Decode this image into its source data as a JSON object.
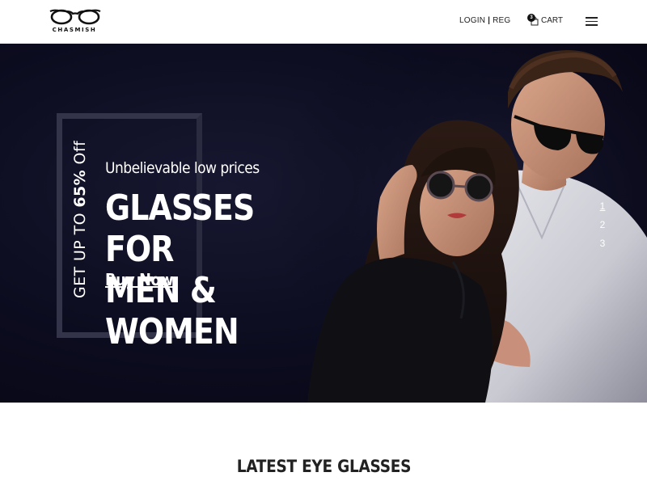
{
  "brand": {
    "name": "CHASMISH"
  },
  "nav": {
    "login": "LOGIN",
    "separator": "|",
    "register": "REG",
    "cart_count": "3",
    "cart_label": "CART"
  },
  "hero": {
    "promo_prefix": "GET UP TO ",
    "promo_highlight": "65%",
    "promo_suffix": " Off",
    "subtitle": "Unbelievable low prices",
    "title_line1": "GLASSES FOR",
    "title_line2": "MEN & WOMEN",
    "cta": "Buy Now",
    "slides": [
      "1",
      "2",
      "3"
    ],
    "active_slide": "1"
  },
  "section": {
    "title": "LATEST EYE GLASSES"
  },
  "colors": {
    "hero_bg": "#0c0c1f",
    "frame": "#33334a",
    "text_light": "#ffffff",
    "text_dark": "#222222"
  },
  "icons": [
    "glasses-logo-icon",
    "bag-icon",
    "hamburger-icon"
  ]
}
